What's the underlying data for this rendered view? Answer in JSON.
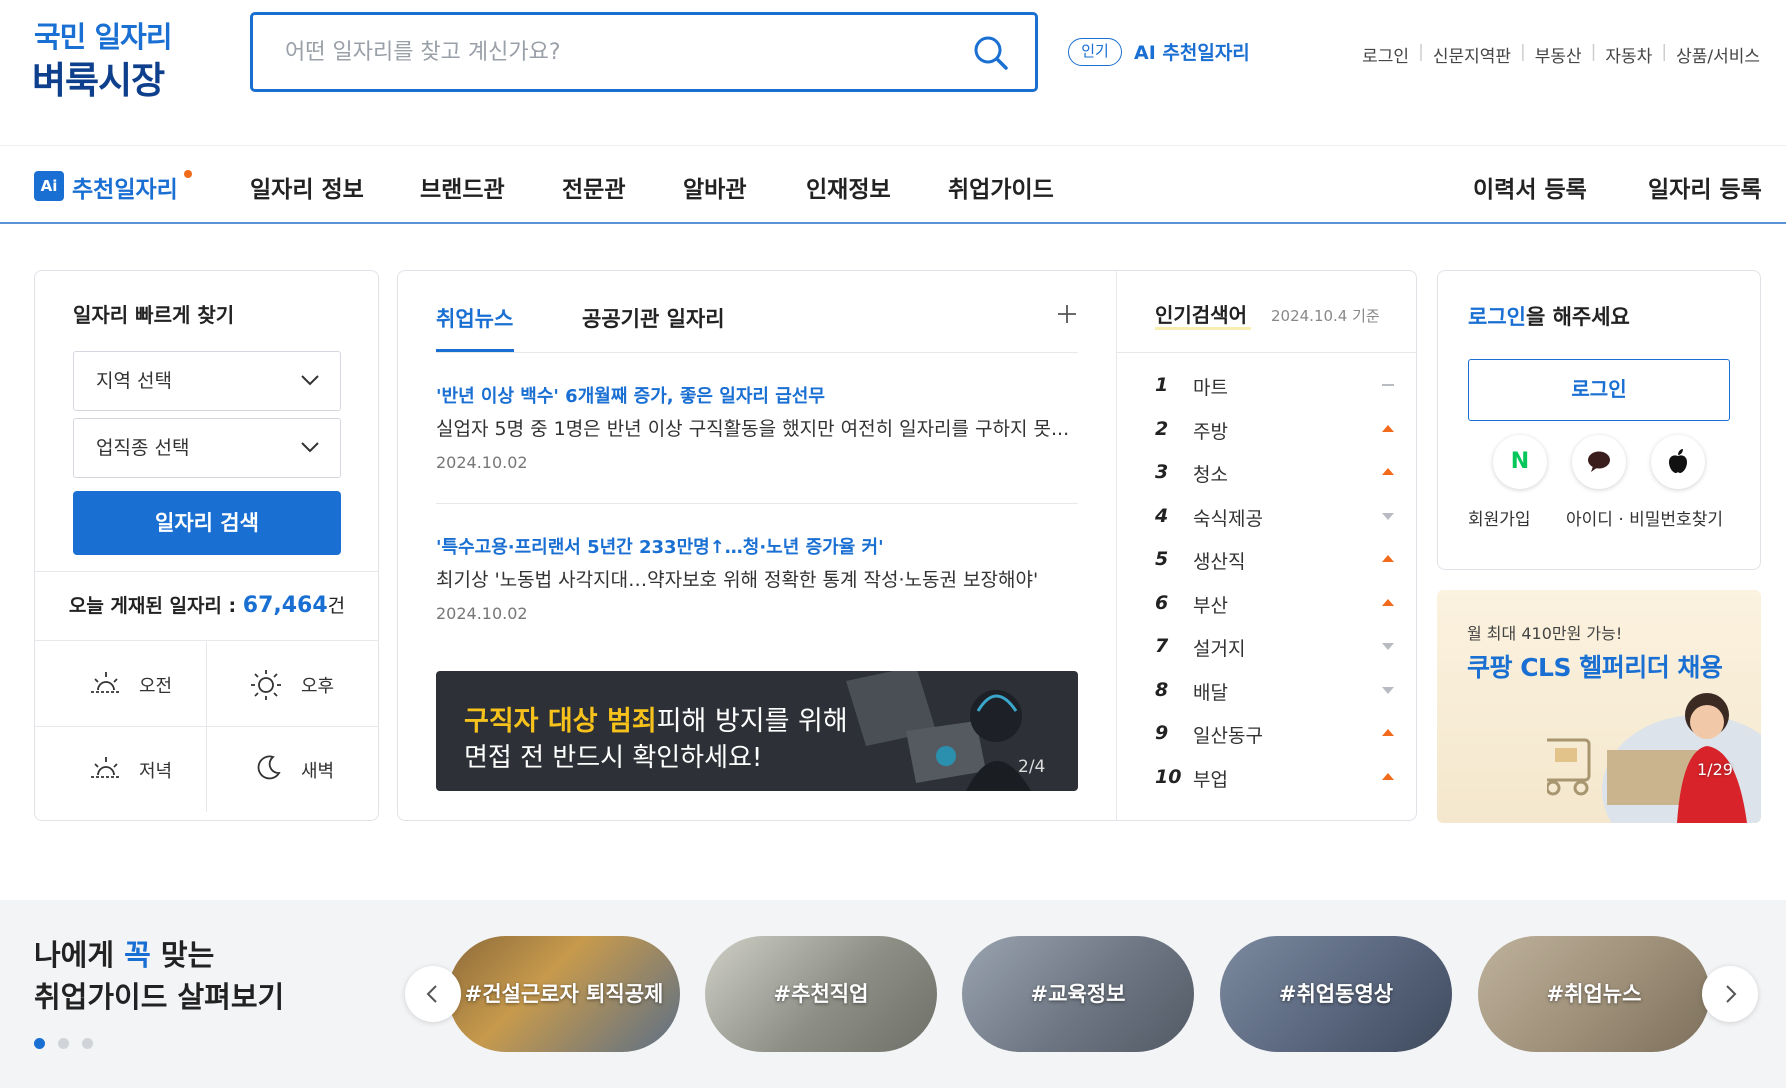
{
  "header": {
    "logo_line1": "국민 일자리",
    "logo_line2": "벼룩시장",
    "search_placeholder": "어떤 일자리를 찾고 계신가요?",
    "popular_badge": "인기",
    "popular_link": "AI 추천일자리",
    "util_links": [
      "로그인",
      "신문지역판",
      "부동산",
      "자동차",
      "상품/서비스"
    ]
  },
  "gnb": {
    "ai_icon": "Ai",
    "ai_label": "추천일자리",
    "items": [
      "일자리 정보",
      "브랜드관",
      "전문관",
      "알바관",
      "인재정보",
      "취업가이드"
    ],
    "right_items": [
      "이력서 등록",
      "일자리 등록"
    ]
  },
  "quick_find": {
    "title": "일자리 빠르게 찾기",
    "region_select": "지역 선택",
    "job_select": "업직종 선택",
    "search_button": "일자리 검색",
    "count_label": "오늘 게재된 일자리 :",
    "count_value": "67,464",
    "count_unit": "건",
    "times": [
      "오전",
      "오후",
      "저녁",
      "새벽"
    ]
  },
  "news": {
    "tabs": [
      "취업뉴스",
      "공공기관 일자리"
    ],
    "items": [
      {
        "title": "'반년 이상 백수' 6개월째 증가, 좋은 일자리 급선무",
        "desc": "실업자 5명 중 1명은 반년 이상 구직활동을 했지만 여전히 일자리를 구하지 못...",
        "date": "2024.10.02"
      },
      {
        "title": "'특수고용·프리랜서 5년간 233만명↑…청·노년 증가율 커'",
        "desc": "최기상 '노동법 사각지대…약자보호 위해 정확한 통계 작성·노동권 보장해야'",
        "date": "2024.10.02"
      }
    ],
    "banner_hl": "구직자 대상 범죄",
    "banner_line1_rest": "피해 방지를 위해",
    "banner_line2": "면접 전 반드시 확인하세요!",
    "banner_page": "2/4"
  },
  "popular": {
    "title": "인기검색어",
    "date": "2024.10.4 기준",
    "ranks": [
      {
        "n": "1",
        "kw": "마트",
        "trend": "same"
      },
      {
        "n": "2",
        "kw": "주방",
        "trend": "up"
      },
      {
        "n": "3",
        "kw": "청소",
        "trend": "up"
      },
      {
        "n": "4",
        "kw": "숙식제공",
        "trend": "down"
      },
      {
        "n": "5",
        "kw": "생산직",
        "trend": "up"
      },
      {
        "n": "6",
        "kw": "부산",
        "trend": "up"
      },
      {
        "n": "7",
        "kw": "설거지",
        "trend": "down"
      },
      {
        "n": "8",
        "kw": "배달",
        "trend": "down"
      },
      {
        "n": "9",
        "kw": "일산동구",
        "trend": "up"
      },
      {
        "n": "10",
        "kw": "부업",
        "trend": "up"
      }
    ]
  },
  "login": {
    "title_blue": "로그인",
    "title_rest": "을 해주세요",
    "button": "로그인",
    "signup": "회원가입",
    "find": "아이디 · 비밀번호찾기",
    "sns_naver": "N"
  },
  "ad": {
    "line1": "월 최대 410만원 가능!",
    "line2": "쿠팡 CLS 헬퍼리더 채용",
    "page": "1/29"
  },
  "guide": {
    "title_a": "나에게 ",
    "title_hl": "꼭",
    "title_b": " 맞는",
    "title_line2": "취업가이드 살펴보기",
    "tags": [
      "#건설근로자 퇴직공제",
      "#추천직업",
      "#교육정보",
      "#취업동영상",
      "#취업뉴스"
    ]
  },
  "colors": {
    "accent": "#1a6fd3",
    "navy": "#0d3f8c",
    "up": "#f26a1b",
    "down": "#b8bcc2"
  }
}
